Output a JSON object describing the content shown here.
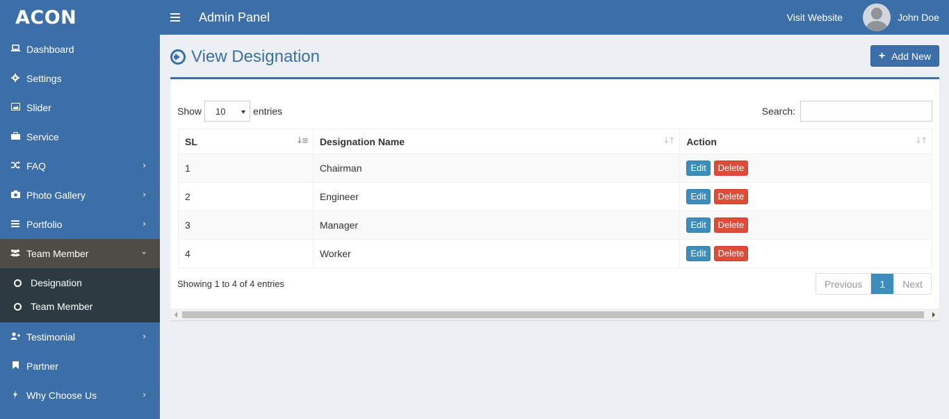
{
  "brand": "ACON",
  "topbar": {
    "title": "Admin Panel",
    "visit_label": "Visit Website",
    "user_name": "John Doe"
  },
  "sidebar": {
    "items": [
      {
        "label": "Dashboard",
        "icon": "laptop-icon"
      },
      {
        "label": "Settings",
        "icon": "gear-icon"
      },
      {
        "label": "Slider",
        "icon": "image-icon"
      },
      {
        "label": "Service",
        "icon": "briefcase-icon"
      },
      {
        "label": "FAQ",
        "icon": "shuffle-icon"
      },
      {
        "label": "Photo Gallery",
        "icon": "camera-icon"
      },
      {
        "label": "Portfolio",
        "icon": "list-icon"
      },
      {
        "label": "Team Member",
        "icon": "users-icon"
      },
      {
        "label": "Testimonial",
        "icon": "user-plus-icon"
      },
      {
        "label": "Partner",
        "icon": "bookmark-icon"
      },
      {
        "label": "Why Choose Us",
        "icon": "bolt-icon"
      }
    ],
    "submenu": [
      {
        "label": "Designation"
      },
      {
        "label": "Team Member"
      }
    ]
  },
  "page": {
    "title": "View Designation",
    "add_label": "Add New"
  },
  "table_controls": {
    "show": "Show",
    "length_value": "10",
    "entries": "entries",
    "search_label": "Search:"
  },
  "table": {
    "headers": [
      "SL",
      "Designation Name",
      "Action"
    ],
    "rows": [
      {
        "sl": "1",
        "name": "Chairman"
      },
      {
        "sl": "2",
        "name": "Engineer"
      },
      {
        "sl": "3",
        "name": "Manager"
      },
      {
        "sl": "4",
        "name": "Worker"
      }
    ],
    "edit_label": "Edit",
    "delete_label": "Delete"
  },
  "footer": {
    "info": "Showing 1 to 4 of 4 entries",
    "previous": "Previous",
    "current_page": "1",
    "next": "Next"
  },
  "colors": {
    "primary": "#3c6fa8",
    "edit": "#3c8dbc",
    "delete": "#dd4b39",
    "sidebar_active": "#4f4b46",
    "submenu_bg": "#2c3b41"
  }
}
